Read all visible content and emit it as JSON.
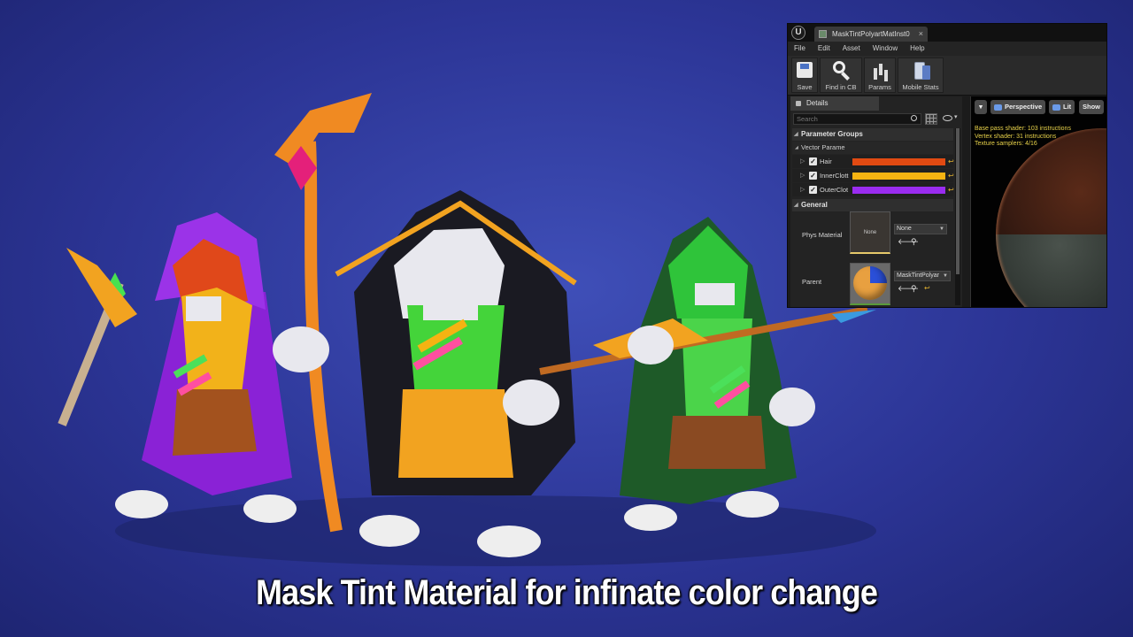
{
  "caption": "Mask Tint Material for infinate color change",
  "colors": {
    "hair": "#e14a12",
    "inner_cloth": "#f5b312",
    "outer_cloth": "#9a2cf0",
    "accent_reset": "#e0b030",
    "stats_text": "#e8d24a"
  },
  "editor": {
    "tab_label": "MaskTintPolyartMatInst0",
    "menu": [
      "File",
      "Edit",
      "Asset",
      "Window",
      "Help"
    ],
    "toolbar": {
      "save": "Save",
      "find_in_cb": "Find in CB",
      "params": "Params",
      "mobile_stats": "Mobile Stats"
    },
    "details": {
      "tab_label": "Details",
      "search_placeholder": "Search",
      "parameter_groups": "Parameter Groups",
      "vector_params": "Vector Parame",
      "params": [
        {
          "name": "Hair",
          "checked": true,
          "color": "#e14a12"
        },
        {
          "name": "InnerClott",
          "checked": true,
          "color": "#f5b312"
        },
        {
          "name": "OuterClot",
          "checked": true,
          "color": "#9a2cf0"
        }
      ],
      "general": "General",
      "phys_material_label": "Phys Material",
      "phys_material_thumb": "None",
      "phys_material_value": "None",
      "parent_label": "Parent",
      "parent_value": "MaskTintPolyar"
    },
    "viewport": {
      "perspective": "Perspective",
      "lit": "Lit",
      "show": "Show",
      "stats": [
        "Base pass shader: 103 instructions",
        "Vertex shader: 31 instructions",
        "Texture samplers: 4/16"
      ]
    }
  }
}
